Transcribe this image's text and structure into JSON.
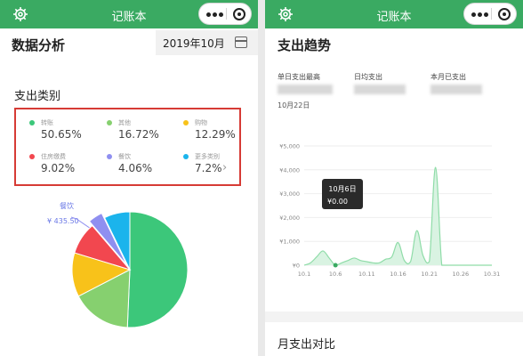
{
  "left": {
    "nav_title": "记账本",
    "page_title": "数据分析",
    "month": "2019年10月",
    "section_title": "支出类别",
    "categories": [
      {
        "name": "转账",
        "percent": "50.65%",
        "color": "#3cc77a"
      },
      {
        "name": "其他",
        "percent": "16.72%",
        "color": "#86d06f"
      },
      {
        "name": "购物",
        "percent": "12.29%",
        "color": "#f8c21a"
      },
      {
        "name": "住房缴费",
        "percent": "9.02%",
        "color": "#f2474f"
      },
      {
        "name": "餐饮",
        "percent": "4.06%",
        "color": "#8f8ff0"
      },
      {
        "name": "更多类别",
        "percent": "7.2%",
        "color": "#1bb4ec"
      }
    ],
    "more_arrow": "›",
    "pie_highlight_name": "餐饮",
    "pie_highlight_amount": "¥ 435.50"
  },
  "right": {
    "nav_title": "记账本",
    "section_title": "支出趋势",
    "stats": [
      {
        "label": "单日支出最高"
      },
      {
        "label": "日均支出"
      },
      {
        "label": "本月已支出"
      }
    ],
    "max_date": "10月22日",
    "tooltip_date": "10月6日",
    "tooltip_value": "¥0.00",
    "bottom_title": "月支出对比"
  },
  "chart_data": [
    {
      "type": "pie",
      "categories": [
        "转账",
        "其他",
        "购物",
        "住房缴费",
        "餐饮",
        "更多类别"
      ],
      "values": [
        50.65,
        16.72,
        12.29,
        9.02,
        4.06,
        7.2
      ],
      "colors": [
        "#3cc77a",
        "#86d06f",
        "#f8c21a",
        "#f2474f",
        "#8f8ff0",
        "#1bb4ec"
      ],
      "highlighted": "餐饮",
      "highlight_label": "¥ 435.50"
    },
    {
      "type": "area",
      "x_ticks": [
        "10.1",
        "10.6",
        "10.11",
        "10.16",
        "10.21",
        "10.26",
        "10.31"
      ],
      "y_ticks": [
        "¥0",
        "¥1,000",
        "¥2,000",
        "¥3,000",
        "¥4,000",
        "¥5,000"
      ],
      "ylim": [
        0,
        5000
      ],
      "xlim": [
        1,
        31
      ],
      "x": [
        1,
        2,
        3,
        4,
        5,
        6,
        7,
        8,
        9,
        10,
        11,
        12,
        13,
        14,
        15,
        16,
        17,
        18,
        19,
        20,
        21,
        22,
        23,
        24,
        25,
        26,
        27,
        28,
        29,
        30,
        31
      ],
      "y": [
        0,
        100,
        350,
        600,
        300,
        0,
        100,
        200,
        300,
        200,
        150,
        100,
        100,
        250,
        350,
        950,
        200,
        150,
        1450,
        400,
        150,
        4100,
        0,
        0,
        0,
        0,
        0,
        0,
        0,
        0,
        0
      ],
      "highlight_point": {
        "x": 6,
        "y": 0
      },
      "line_color": "#8fdca8",
      "fill_color": "#d9f3e2",
      "grid": true
    }
  ]
}
